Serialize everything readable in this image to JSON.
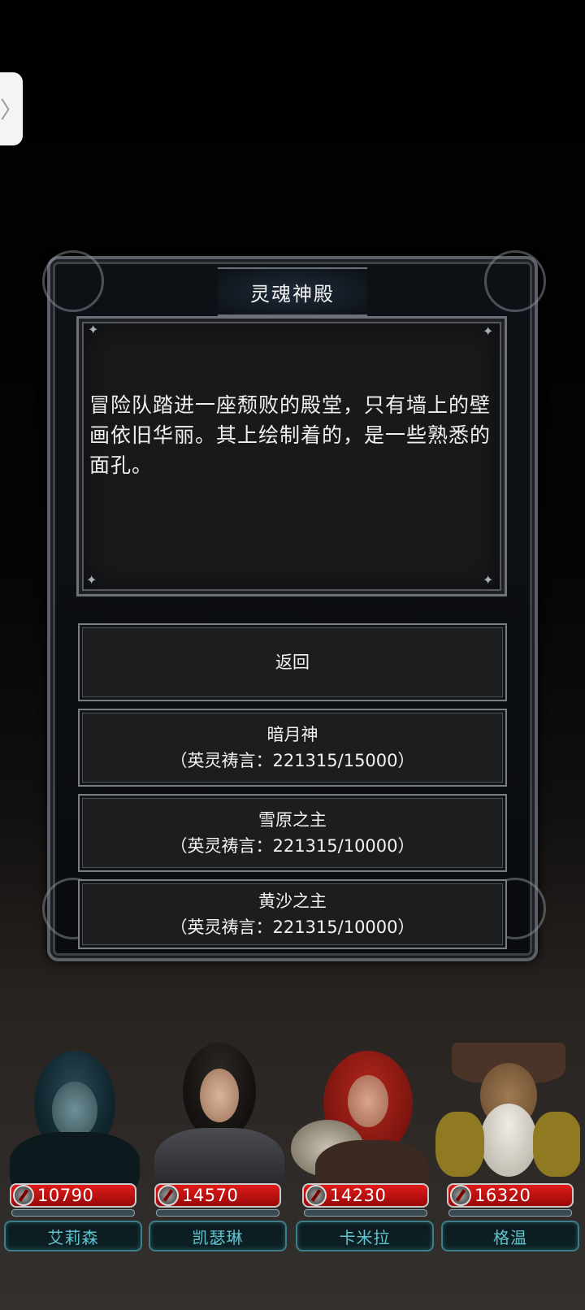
{
  "side_tab": {
    "glyph": "〉"
  },
  "dialog": {
    "title": "灵魂神殿",
    "description": "冒险队踏进一座颓败的殿堂，只有墙上的壁画依旧华丽。其上绘制着的，是一些熟悉的面孔。",
    "options": [
      {
        "label": "返回",
        "detail": ""
      },
      {
        "label": "暗月神",
        "detail": "（英灵祷言：221315/15000）"
      },
      {
        "label": "雪原之主",
        "detail": "（英灵祷言：221315/10000）"
      },
      {
        "label": "黄沙之主",
        "detail": "（英灵祷言：221315/10000）"
      }
    ]
  },
  "party": [
    {
      "name": "艾莉森",
      "hp": "10790"
    },
    {
      "name": "凯瑟琳",
      "hp": "14570"
    },
    {
      "name": "卡米拉",
      "hp": "14230"
    },
    {
      "name": "格温",
      "hp": "16320"
    }
  ],
  "colors": {
    "hp_red": "#d01212",
    "name_teal": "#5fc4cf",
    "frame_steel": "#6e7178"
  },
  "icons": [
    "chevron-right-icon",
    "sword-shield-icon",
    "sparkle-icon"
  ]
}
